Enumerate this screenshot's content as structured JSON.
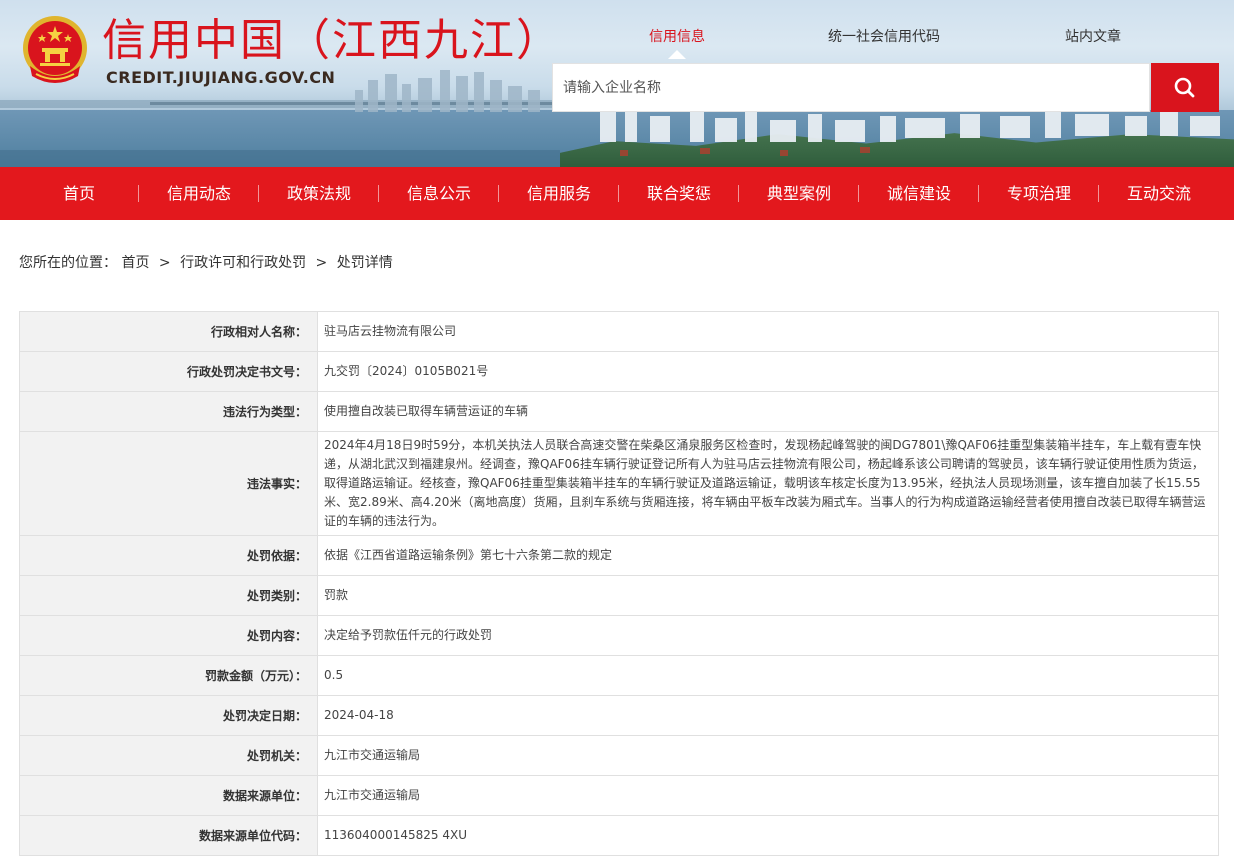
{
  "header": {
    "title": "信用中国（江西九江）",
    "domain": "CREDIT.JIUJIANG.GOV.CN",
    "top_tabs": [
      {
        "label": "信用信息",
        "active": true
      },
      {
        "label": "统一社会信用代码",
        "active": false
      },
      {
        "label": "站内文章",
        "active": false
      }
    ],
    "search": {
      "placeholder": "请输入企业名称",
      "value": ""
    },
    "accent_color": "#d9141d"
  },
  "nav": {
    "items": [
      "首页",
      "信用动态",
      "政策法规",
      "信息公示",
      "信用服务",
      "联合奖惩",
      "典型案例",
      "诚信建设",
      "专项治理",
      "互动交流"
    ]
  },
  "breadcrumb": {
    "prefix": "您所在的位置：",
    "items": [
      "首页",
      "行政许可和行政处罚",
      "处罚详情"
    ],
    "separator": ">"
  },
  "detail": {
    "rows": [
      {
        "label": "行政相对人名称：",
        "value": "驻马店云挂物流有限公司"
      },
      {
        "label": "行政处罚决定书文号：",
        "value": "九交罚〔2024〕0105B021号"
      },
      {
        "label": "违法行为类型：",
        "value": "使用擅自改装已取得车辆营运证的车辆"
      },
      {
        "label": "违法事实：",
        "value": "2024年4月18日9时59分，本机关执法人员联合高速交警在柴桑区涌泉服务区检查时，发现杨起峰驾驶的闽DG7801\\豫QAF06挂重型集装箱半挂车，车上载有壹车快递，从湖北武汉到福建泉州。经调查，豫QAF06挂车辆行驶证登记所有人为驻马店云挂物流有限公司，杨起峰系该公司聘请的驾驶员，该车辆行驶证使用性质为货运，取得道路运输证。经核查，豫QAF06挂重型集装箱半挂车的车辆行驶证及道路运输证，载明该车核定长度为13.95米，经执法人员现场测量，该车擅自加装了长15.55米、宽2.89米、高4.20米（离地高度）货厢，且刹车系统与货厢连接，将车辆由平板车改装为厢式车。当事人的行为构成道路运输经营者使用擅自改装已取得车辆营运证的车辆的违法行为。"
      },
      {
        "label": "处罚依据：",
        "value": "依据《江西省道路运输条例》第七十六条第二款的规定"
      },
      {
        "label": "处罚类别：",
        "value": "罚款"
      },
      {
        "label": "处罚内容：",
        "value": "决定给予罚款伍仟元的行政处罚"
      },
      {
        "label": "罚款金额（万元）：",
        "value": "0.5"
      },
      {
        "label": "处罚决定日期：",
        "value": "2024-04-18"
      },
      {
        "label": "处罚机关：",
        "value": "九江市交通运输局"
      },
      {
        "label": "数据来源单位：",
        "value": "九江市交通运输局"
      },
      {
        "label": "数据来源单位代码：",
        "value": "113604000145825 4XU"
      }
    ]
  }
}
